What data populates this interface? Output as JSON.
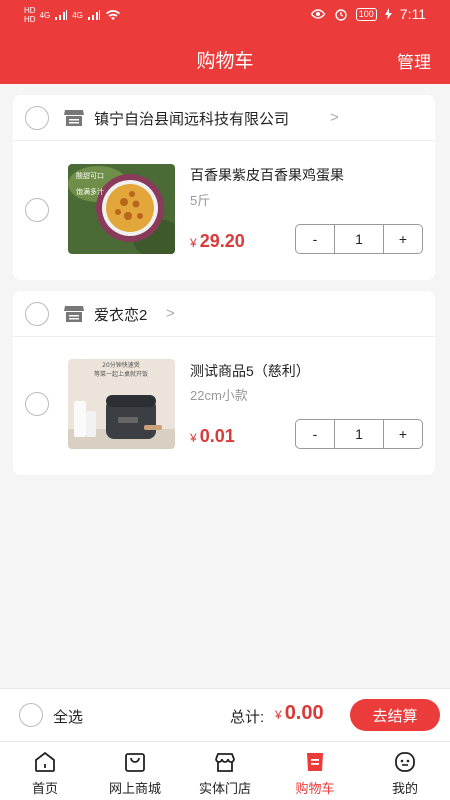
{
  "status_bar": {
    "left_indicators": [
      "HD",
      "HD",
      "4G",
      "4G"
    ],
    "battery": "100",
    "time": "7:11"
  },
  "header": {
    "title": "购物车",
    "manage": "管理"
  },
  "stores": [
    {
      "name": "镇宁自治县闻远科技有限公司",
      "chevron": ">",
      "product": {
        "name": "百香果紫皮百香果鸡蛋果",
        "spec": "5斤",
        "currency": "¥",
        "price": "29.20",
        "minus": "-",
        "qty": "1",
        "plus": "+",
        "image_text": [
          "酸甜可口",
          "饱满多汁"
        ]
      }
    },
    {
      "name": "爱衣恋2",
      "chevron": ">",
      "product": {
        "name": "测试商品5（慈利）",
        "spec": "22cm小款",
        "currency": "¥",
        "price": "0.01",
        "minus": "-",
        "qty": "1",
        "plus": "+",
        "image_text": [
          "20分钟快速煲",
          "等菜一起上桌就开饭"
        ]
      }
    }
  ],
  "bottom_bar": {
    "select_all": "全选",
    "total_label": "总计:",
    "currency": "¥",
    "total": "0.00",
    "checkout": "去结算"
  },
  "tabs": [
    {
      "label": "首页",
      "icon": "home-icon"
    },
    {
      "label": "网上商城",
      "icon": "shopping-bag-icon"
    },
    {
      "label": "实体门店",
      "icon": "store-icon"
    },
    {
      "label": "购物车",
      "icon": "cart-icon",
      "active": true
    },
    {
      "label": "我的",
      "icon": "profile-icon"
    }
  ],
  "colors": {
    "accent": "#ec3b3b",
    "price": "#d93a3a",
    "background": "#f5f5f5"
  }
}
